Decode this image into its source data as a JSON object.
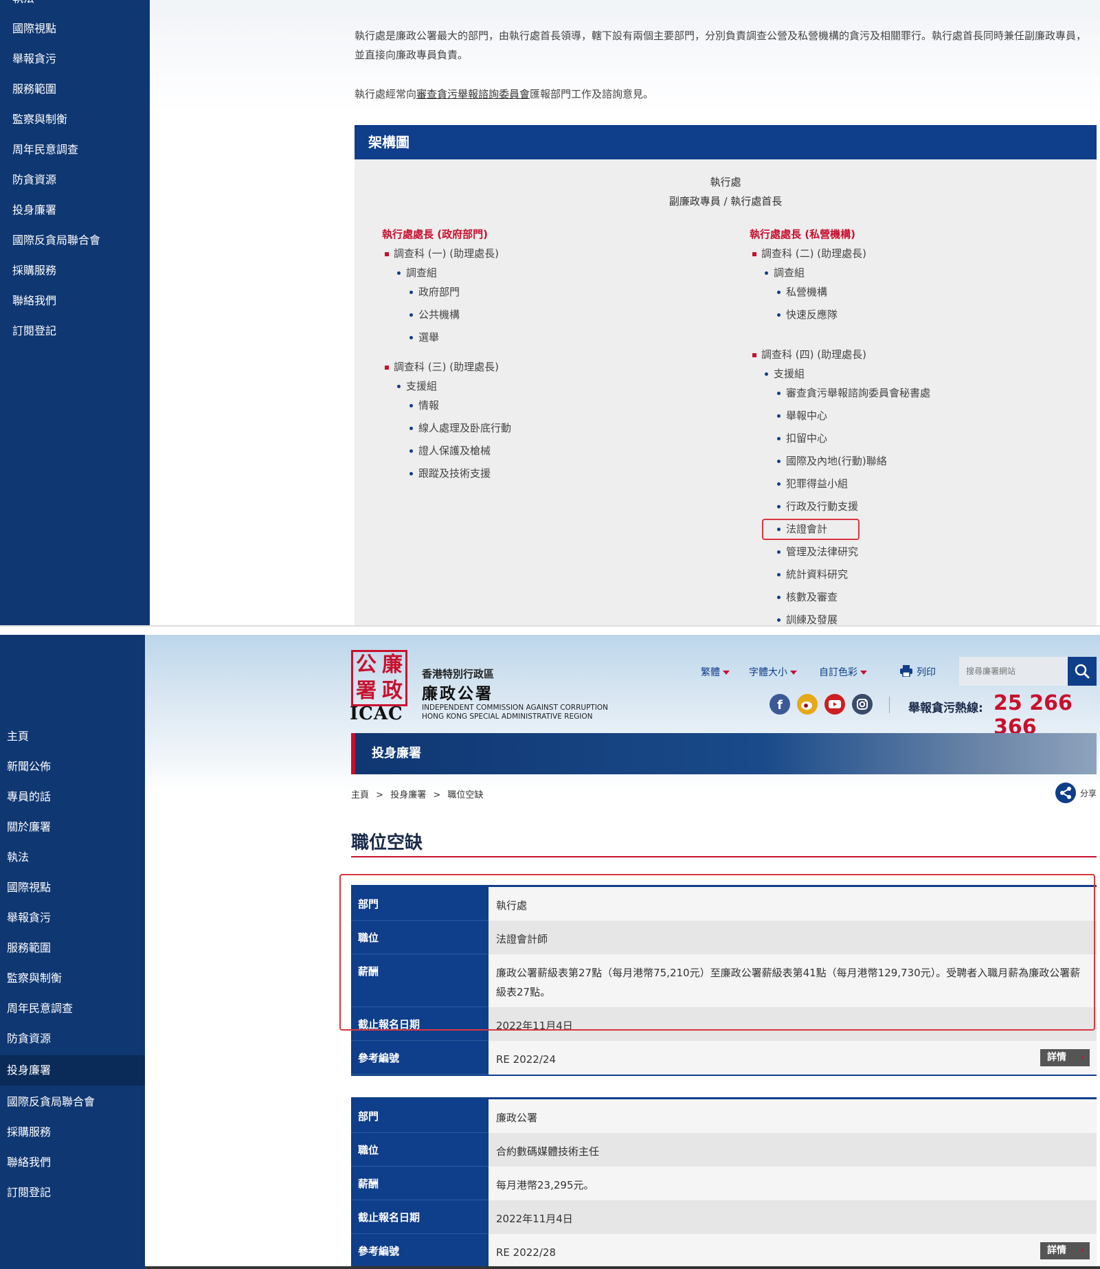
{
  "top_pane": {
    "sidebar": {
      "cut_item": "執法",
      "items": [
        "國際視點",
        "舉報貪污",
        "服務範圍",
        "監察與制衡",
        "周年民意調查",
        "防貪資源",
        "投身廉署",
        "國際反貪局聯合會",
        "採購服務",
        "聯絡我們",
        "訂閱登記"
      ]
    },
    "intro": {
      "p1": "執行處是廉政公署最大的部門，由執行處首長領導，轄下設有兩個主要部門，分別負責調查公營及私營機構的貪污及相關罪行。執行處首長同時兼任副廉政專員，並直接向廉政專員負責。",
      "p2_before": "執行處經常向",
      "p2_link": "審查貪污舉報諮詢委員會",
      "p2_after": "匯報部門工作及諮詢意見。"
    },
    "org_chart": {
      "header": "架構圖",
      "top_title": "執行處",
      "top_subtitle": "副廉政專員 / 執行處首長",
      "left": {
        "title": "執行處處長 (政府部門)",
        "branch1": "調查科 (一) (助理處長)",
        "branch1_group": "調查組",
        "branch1_items": [
          "政府部門",
          "公共機構",
          "選舉"
        ],
        "branch2": "調查科 (三) (助理處長)",
        "branch2_group": "支援組",
        "branch2_items": [
          "情報",
          "線人處理及卧底行動",
          "證人保護及槍械",
          "跟蹤及技術支援"
        ]
      },
      "right": {
        "title": "執行處處長 (私營機構)",
        "branch1": "調查科 (二) (助理處長)",
        "branch1_group": "調查組",
        "branch1_items": [
          "私營機構",
          "快速反應隊"
        ],
        "branch2": "調查科 (四) (助理處長)",
        "branch2_group": "支援組",
        "branch2_items": [
          "審查貪污舉報諮詢委員會秘書處",
          "舉報中心",
          "扣留中心",
          "國際及內地(行動)聯絡",
          "犯罪得益小組",
          "行政及行動支援",
          "法證會計",
          "管理及法律研究",
          "統計資料研究",
          "核數及審查",
          "訓練及發展"
        ]
      }
    }
  },
  "bottom_pane": {
    "sidebar": {
      "items": [
        "主頁",
        "新聞公佈",
        "專員的話",
        "關於廉署",
        "執法",
        "國際視點",
        "舉報貪污",
        "服務範圍",
        "監察與制衡",
        "周年民意調查",
        "防貪資源",
        "投身廉署",
        "國際反貪局聯合會",
        "採購服務",
        "聯絡我們",
        "訂閱登記"
      ],
      "active_index": 11
    },
    "logo": {
      "chars": [
        "廉",
        "政",
        "公",
        "署"
      ],
      "icac": "ICAC",
      "line1": "香港特別行政區",
      "line2": "廉政公署",
      "line3": "INDEPENDENT COMMISSION AGAINST CORRUPTION",
      "line4": "HONG KONG SPECIAL ADMINISTRATIVE REGION"
    },
    "tools": {
      "lang": "繁體",
      "font_size": "字體大小",
      "color": "自訂色彩",
      "print": "列印"
    },
    "search": {
      "placeholder": "搜尋廉署網站"
    },
    "social": [
      "facebook-icon",
      "weibo-icon",
      "youtube-icon",
      "instagram-icon"
    ],
    "hotline": {
      "label": "舉報貪污熱線:",
      "number": "25 266 366"
    },
    "banner": {
      "title": "投身廉署"
    },
    "breadcrumb": {
      "items": [
        "主頁",
        "投身廉署",
        "職位空缺"
      ],
      "separator": ">"
    },
    "share_label": "分享",
    "page_title": "職位空缺",
    "jobs": [
      {
        "rows": [
          {
            "label": "部門",
            "value": "執行處"
          },
          {
            "label": "職位",
            "value": "法證會計師"
          },
          {
            "label": "薪酬",
            "value": "廉政公署薪級表第27點（每月港幣75,210元）至廉政公署薪級表第41點（每月港幣129,730元）。受聘者入職月薪為廉政公署薪級表27點。"
          },
          {
            "label": "截止報名日期",
            "value": "2022年11月4日"
          },
          {
            "label": "參考編號",
            "value": "RE 2022/24"
          }
        ],
        "details_label": "詳情"
      },
      {
        "rows": [
          {
            "label": "部門",
            "value": "廉政公署"
          },
          {
            "label": "職位",
            "value": "合約數碼媒體技術主任"
          },
          {
            "label": "薪酬",
            "value": "每月港幣23,295元。"
          },
          {
            "label": "截止報名日期",
            "value": "2022年11月4日"
          },
          {
            "label": "參考編號",
            "value": "RE 2022/28"
          }
        ],
        "details_label": "詳情"
      }
    ]
  },
  "colors": {
    "navy": "#0f3772",
    "brand_blue": "#0f3e8a",
    "brand_red": "#c8102e",
    "highlight": "#d9363e"
  }
}
